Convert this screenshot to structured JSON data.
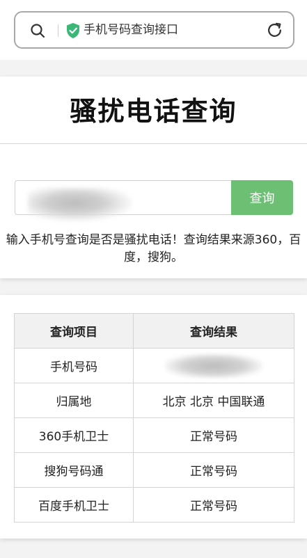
{
  "browser": {
    "url_title": "手机号码查询接口",
    "colors": {
      "shield": "#3bb878",
      "border": "#a8a8a8"
    }
  },
  "header": {
    "title": "骚扰电话查询"
  },
  "search": {
    "input_value": "",
    "button_label": "查询",
    "button_color": "#6dbf73"
  },
  "description": "输入手机号查询是否是骚扰电话！查询结果来源360，百度，搜狗。",
  "results": {
    "headers": [
      "查询项目",
      "查询结果"
    ],
    "rows": [
      {
        "item": "手机号码",
        "result": ""
      },
      {
        "item": "归属地",
        "result": "北京 北京 中国联通"
      },
      {
        "item": "360手机卫士",
        "result": "正常号码"
      },
      {
        "item": "搜狗号码通",
        "result": "正常号码"
      },
      {
        "item": "百度手机卫士",
        "result": "正常号码"
      }
    ]
  }
}
